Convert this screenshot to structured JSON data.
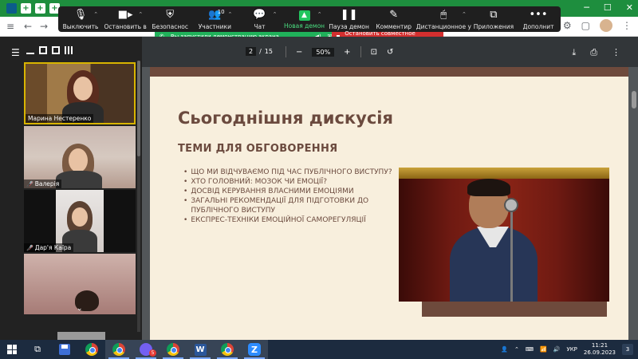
{
  "zoom_toolbar": {
    "items": [
      {
        "label": "Выключить",
        "icon": "microphone-icon"
      },
      {
        "label": "Остановить в",
        "icon": "video-camera-icon"
      },
      {
        "label": "Безопаснос",
        "icon": "shield-icon"
      },
      {
        "label": "Участники",
        "icon": "participants-icon",
        "count": "10"
      },
      {
        "label": "Чат",
        "icon": "chat-icon"
      },
      {
        "label": "Новая демон",
        "icon": "share-screen-icon"
      },
      {
        "label": "Пауза демон",
        "icon": "pause-icon"
      },
      {
        "label": "Комментир",
        "icon": "pen-icon"
      },
      {
        "label": "Дистанционное у",
        "icon": "remote-control-icon"
      },
      {
        "label": "Приложения",
        "icon": "apps-icon"
      },
      {
        "label": "Дополнит",
        "icon": "more-icon"
      }
    ]
  },
  "share_banner": {
    "status": "Вы запустили демонстрацию экрана",
    "stop_label": "Остановить совместное использование"
  },
  "participants": [
    {
      "name": "Марина Нестеренко",
      "muted": false
    },
    {
      "name": "Валерія",
      "muted": true
    },
    {
      "name": "Дар'я Каїра",
      "muted": true
    }
  ],
  "pdf_viewer": {
    "current_page": "2",
    "page_separator": "/",
    "total_pages": "15",
    "zoom": "50%"
  },
  "slide": {
    "title": "Сьогоднішня дискусія",
    "subtitle": "ТЕМИ ДЛЯ ОБГОВОРЕННЯ",
    "bullets": [
      "ЩО МИ ВІДЧУВАЄМО ПІД ЧАС ПУБЛІЧНОГО ВИСТУПУ?",
      "ХТО ГОЛОВНИЙ: МОЗОК ЧИ ЕМОЦІЇ?",
      "ДОСВІД КЕРУВАННЯ ВЛАСНИМИ ЕМОЦІЯМИ",
      "ЗАГАЛЬНІ РЕКОМЕНДАЦІЇ ДЛЯ ПІДГОТОВКИ ДО ПУБЛІЧНОГО ВИСТУПУ",
      "ЕКСПРЕС-ТЕХНІКИ ЕМОЦІЙНОЇ САМОРЕГУЛЯЦІЇ"
    ]
  },
  "taskbar": {
    "language": "УКР",
    "time": "11:21",
    "date": "26.09.2023",
    "viber_badge": "5",
    "notification_count": "3"
  },
  "colors": {
    "slide_text": "#6b4a3e",
    "slide_bg": "#f8efdd",
    "share_green": "#20b15a",
    "share_red": "#d32f2f",
    "zoom_toolbar_bg": "#1f1f1f"
  }
}
